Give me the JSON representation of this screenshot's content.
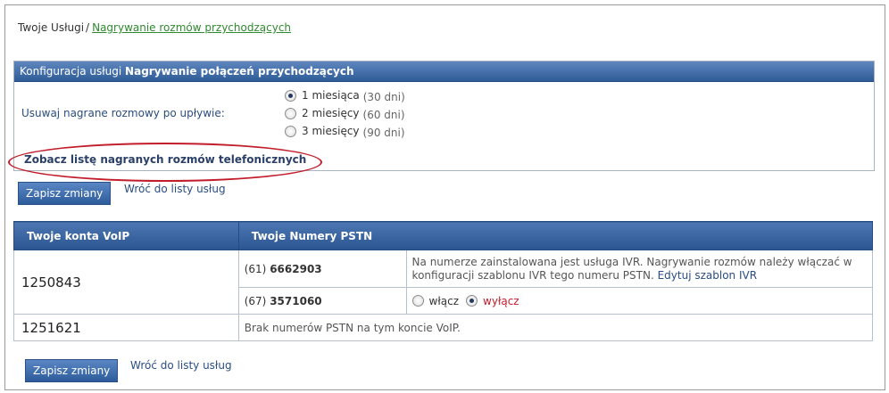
{
  "breadcrumb": {
    "root": "Twoje Usługi",
    "separator": "/",
    "current": "Nagrywanie rozmów przychodzących"
  },
  "config": {
    "header_prefix": "Konfiguracja usługi",
    "header_bold": "Nagrywanie połączeń przychodzących",
    "retention_label": "Usuwaj nagrane rozmowy po upływie:",
    "options": [
      {
        "label": "1 miesiąca",
        "days": "(30 dni)",
        "selected": true
      },
      {
        "label": "2 miesięcy",
        "days": "(60 dni)",
        "selected": false
      },
      {
        "label": "3 miesięcy",
        "days": "(90 dni)",
        "selected": false
      }
    ],
    "see_list_link": "Zobacz listę nagranych rozmów telefonicznych"
  },
  "actions": {
    "save_label": "Zapisz zmiany",
    "back_label": "Wróć do listy usług"
  },
  "table": {
    "headers": [
      "Twoje konta VoIP",
      "Twoje Numery PSTN"
    ],
    "accounts": [
      {
        "id": "1250843",
        "numbers": [
          {
            "prefix": "(61)",
            "number": "6662903",
            "info": "Na numerze zainstalowana jest usługa IVR. Nagrywanie rozmów należy włączać w konfiguracji szablonu IVR tego numeru PSTN.",
            "info_link": "Edytuj szablon IVR"
          },
          {
            "prefix": "(67)",
            "number": "3571060",
            "toggle_on": "włącz",
            "toggle_off": "wyłącz",
            "selected": "wyłącz"
          }
        ]
      },
      {
        "id": "1251621",
        "no_numbers_text": "Brak numerów PSTN na tym koncie VoIP."
      }
    ]
  },
  "colors": {
    "header_blue": "#2f5c97",
    "link_blue": "#2a4d83",
    "breadcrumb_green": "#2f8a2f",
    "highlight_red": "#c11d2b"
  }
}
